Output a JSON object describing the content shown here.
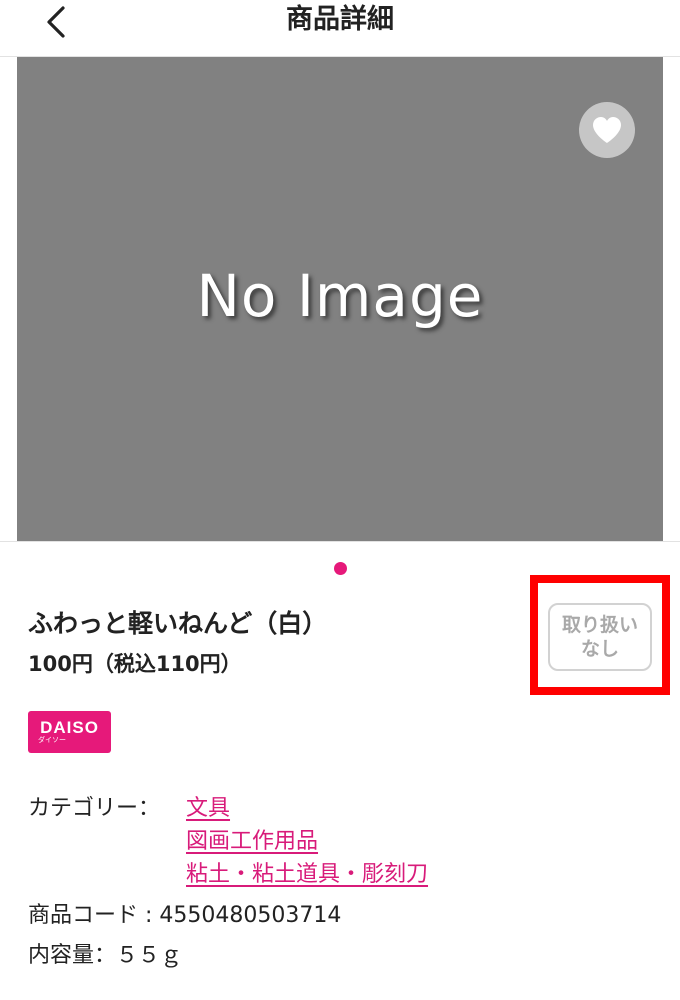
{
  "header": {
    "title": "商品詳細",
    "back_icon": "chevron-left-icon"
  },
  "image": {
    "placeholder_text": "No Image",
    "favorite_icon": "heart-icon",
    "carousel_pages": 1,
    "carousel_active": 1
  },
  "product": {
    "name": "ふわっと軽いねんど（白）",
    "price": "100円（税込110円）",
    "availability_line1": "取り扱い",
    "availability_line2": "なし",
    "brand": {
      "main": "DAISO",
      "sub": "ダイソー"
    }
  },
  "details": {
    "category_label": "カテゴリー：",
    "categories": [
      "文具",
      "図画工作用品",
      "粘土・粘土道具・彫刻刀"
    ],
    "code_label": "商品コード : 4550480503714",
    "volume_label": "内容量：５５ｇ"
  },
  "colors": {
    "accent": "#e6197a",
    "link": "#d81b7a",
    "highlight": "#ff0000",
    "image_bg": "#818181"
  }
}
